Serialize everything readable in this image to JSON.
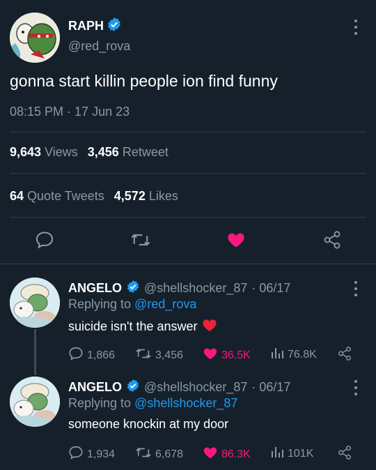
{
  "main": {
    "name": "RAPH",
    "handle": "@red_rova",
    "text": "gonna start killin people ion find funny",
    "timestamp": "08:15 PM · 17 Jun 23",
    "views_count": "9,643",
    "views_label": "Views",
    "retweet_count": "3,456",
    "retweet_label": "Retweet",
    "quote_count": "64",
    "quote_label": "Quote Tweets",
    "likes_count": "4,572",
    "likes_label": "Likes"
  },
  "replies": [
    {
      "name": "ANGELO",
      "handle": "@shellshocker_87",
      "date": "· 06/17",
      "replying_label": "Replying to",
      "replying_to": "@red_rova",
      "text": "suicide isn't the answer",
      "comments": "1,866",
      "retweets": "3,456",
      "likes": "36.5K",
      "views": "76.8K"
    },
    {
      "name": "ANGELO",
      "handle": "@shellshocker_87",
      "date": "· 06/17",
      "replying_label": "Replying to",
      "replying_to": "@shellshocker_87",
      "text": "someone knockin at my door",
      "comments": "1,934",
      "retweets": "6,678",
      "likes": "86.3K",
      "views": "101K"
    }
  ],
  "colors": {
    "background": "#15202b",
    "accent": "#1d9bf0",
    "like": "#f91880",
    "muted": "#8b98a5"
  }
}
